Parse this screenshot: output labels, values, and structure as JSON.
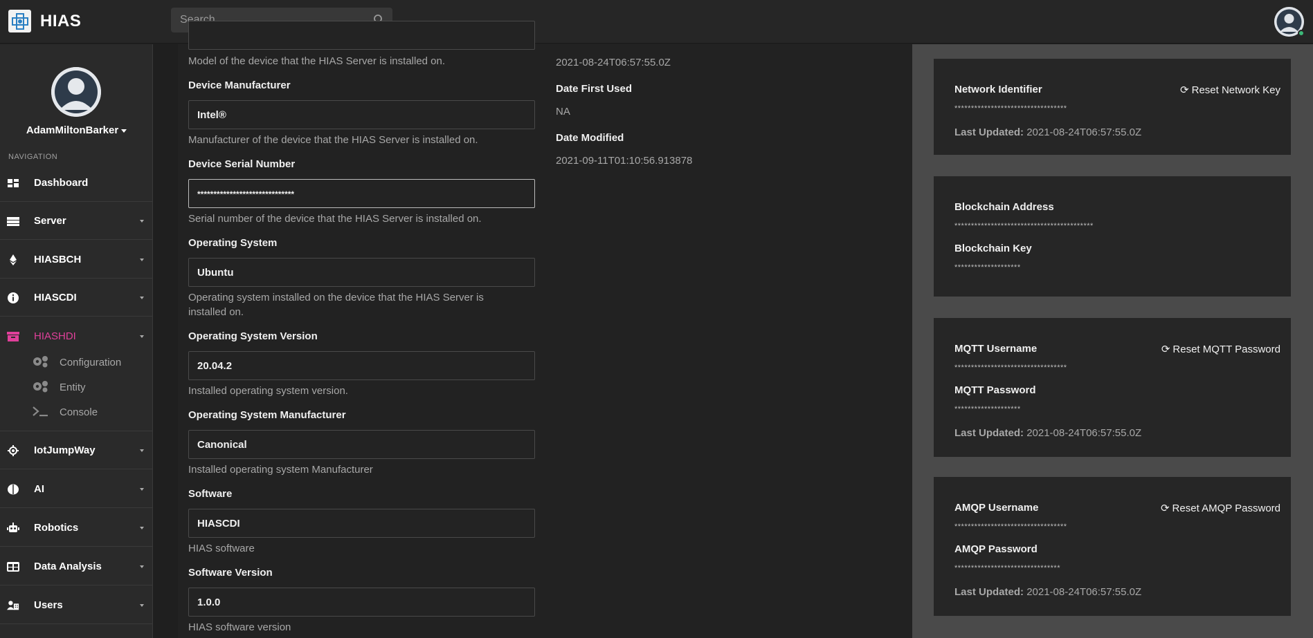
{
  "app": {
    "brand": "HIAS"
  },
  "search": {
    "placeholder": "Search"
  },
  "sidebar": {
    "username": "AdamMiltonBarker",
    "nav_heading": "NAVIGATION",
    "items": [
      {
        "label": "Dashboard",
        "icon": "dashboard-icon"
      },
      {
        "label": "Server",
        "icon": "server-icon"
      },
      {
        "label": "HIASBCH",
        "icon": "ethereum-icon"
      },
      {
        "label": "HIASCDI",
        "icon": "info-circle-icon"
      },
      {
        "label": "HIASHDI",
        "icon": "archive-icon"
      },
      {
        "label": "IotJumpWay",
        "icon": "iot-icon"
      },
      {
        "label": "AI",
        "icon": "brain-icon"
      },
      {
        "label": "Robotics",
        "icon": "robot-icon"
      },
      {
        "label": "Data Analysis",
        "icon": "table-icon"
      },
      {
        "label": "Users",
        "icon": "users-icon"
      }
    ],
    "subitems": [
      {
        "label": "Configuration",
        "icon": "gears-icon"
      },
      {
        "label": "Entity",
        "icon": "gears-icon"
      },
      {
        "label": "Console",
        "icon": "terminal-icon"
      }
    ]
  },
  "form": {
    "model_help": "Model of the device that the HIAS Server is installed on.",
    "manufacturer_label": "Device Manufacturer",
    "manufacturer_value": "Intel®",
    "manufacturer_help": "Manufacturer of the device that the HIAS Server is installed on.",
    "serial_label": "Device Serial Number",
    "serial_value": "******************************",
    "serial_help": "Serial number of the device that the HIAS Server is installed on.",
    "os_label": "Operating System",
    "os_value": "Ubuntu",
    "os_help_1": "Operating system installed on the device that the HIAS Server is",
    "os_help_2": "installed on.",
    "osv_label": "Operating System Version",
    "osv_value": "20.04.2",
    "osv_help": "Installed operating system version.",
    "osm_label": "Operating System Manufacturer",
    "osm_value": "Canonical",
    "osm_help": "Installed operating system Manufacturer",
    "software_label": "Software",
    "software_value": "HIASCDI",
    "software_help": "HIAS software",
    "swv_label": "Software Version",
    "swv_value": "1.0.0",
    "swv_help": "HIAS software version"
  },
  "info": {
    "date_created_value": "2021-08-24T06:57:55.0Z",
    "first_used_label": "Date First Used",
    "first_used_value": "NA",
    "modified_label": "Date Modified",
    "modified_value": "2021-09-11T01:10:56.913878"
  },
  "cards": {
    "network": {
      "label": "Network Identifier",
      "masked": "**********************************",
      "reset": "Reset Network Key",
      "updated_label": "Last Updated:",
      "updated_value": "2021-08-24T06:57:55.0Z"
    },
    "blockchain": {
      "address_label": "Blockchain Address",
      "address_masked": "******************************************",
      "key_label": "Blockchain Key",
      "key_masked": "********************"
    },
    "mqtt": {
      "username_label": "MQTT Username",
      "username_masked": "**********************************",
      "reset": "Reset MQTT Password",
      "password_label": "MQTT Password",
      "password_masked": "********************",
      "updated_label": "Last Updated:",
      "updated_value": "2021-08-24T06:57:55.0Z"
    },
    "amqp": {
      "username_label": "AMQP Username",
      "username_masked": "**********************************",
      "reset": "Reset AMQP Password",
      "password_label": "AMQP Password",
      "password_masked": "********************************",
      "updated_label": "Last Updated:",
      "updated_value": "2021-08-24T06:57:55.0Z"
    }
  },
  "colors": {
    "accent": "#e0409a",
    "online": "#3cb878"
  }
}
